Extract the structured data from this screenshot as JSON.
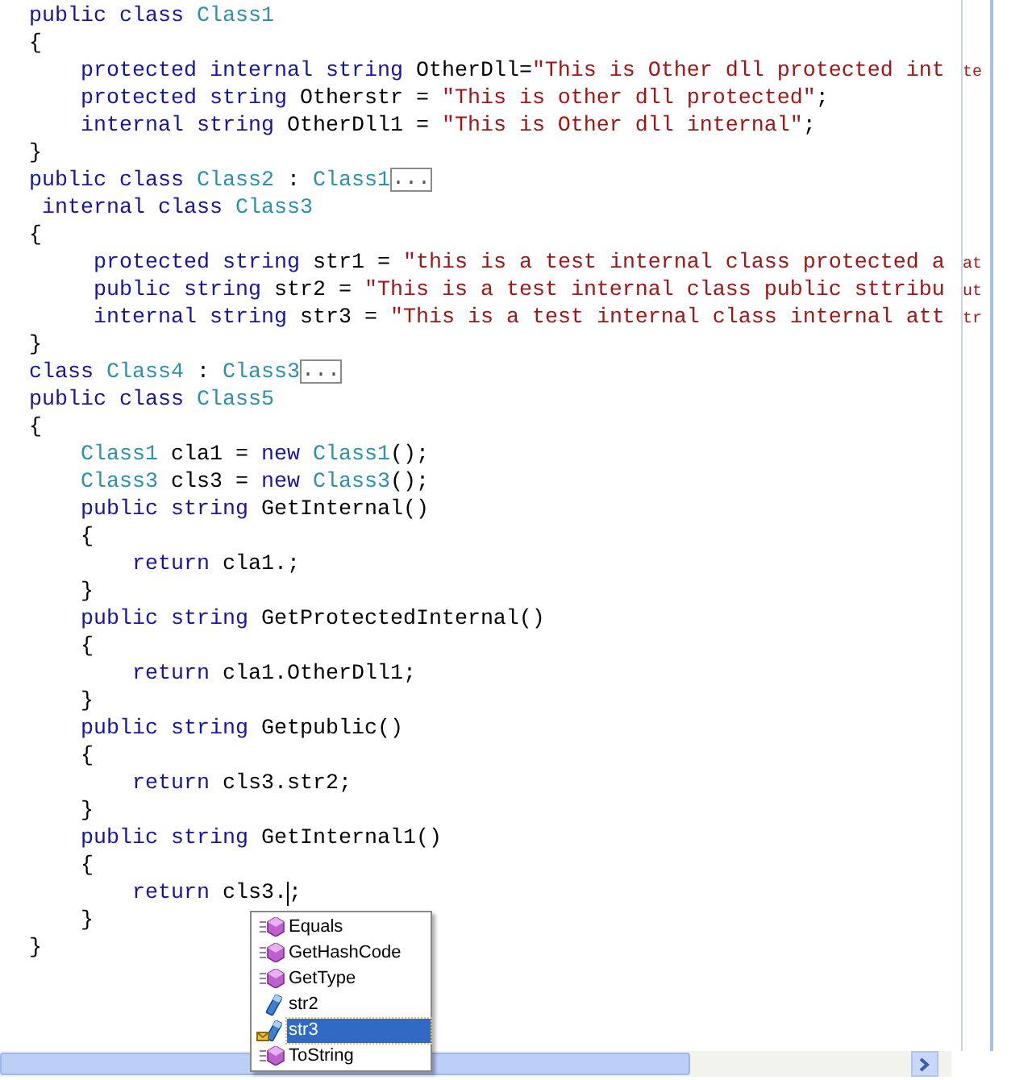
{
  "editor": {
    "lines": [
      {
        "tokens": [
          {
            "kind": "keyword",
            "text": "public class "
          },
          {
            "kind": "type",
            "text": "Class1"
          }
        ]
      },
      {
        "tokens": [
          {
            "kind": "plain",
            "text": "{"
          }
        ]
      },
      {
        "tokens": [
          {
            "kind": "keyword",
            "text": "    protected internal string "
          },
          {
            "kind": "plain",
            "text": "OtherDll="
          },
          {
            "kind": "string",
            "text": "\"This is Other dll protected int"
          }
        ],
        "margin_text": "te"
      },
      {
        "tokens": [
          {
            "kind": "keyword",
            "text": "    protected string "
          },
          {
            "kind": "plain",
            "text": "Otherstr = "
          },
          {
            "kind": "string",
            "text": "\"This is other dll protected\""
          },
          {
            "kind": "plain",
            "text": ";"
          }
        ]
      },
      {
        "tokens": [
          {
            "kind": "keyword",
            "text": "    internal string "
          },
          {
            "kind": "plain",
            "text": "OtherDll1 = "
          },
          {
            "kind": "string",
            "text": "\"This is Other dll internal\""
          },
          {
            "kind": "plain",
            "text": ";"
          }
        ]
      },
      {
        "tokens": [
          {
            "kind": "plain",
            "text": "}"
          }
        ]
      },
      {
        "tokens": [
          {
            "kind": "keyword",
            "text": "public class "
          },
          {
            "kind": "type",
            "text": "Class2"
          },
          {
            "kind": "plain",
            "text": " : "
          },
          {
            "kind": "type",
            "text": "Class1"
          },
          {
            "kind": "collapsed",
            "text": "..."
          }
        ]
      },
      {
        "tokens": [
          {
            "kind": "keyword",
            "text": " internal class "
          },
          {
            "kind": "type",
            "text": "Class3"
          }
        ]
      },
      {
        "tokens": [
          {
            "kind": "plain",
            "text": "{"
          }
        ]
      },
      {
        "tokens": [
          {
            "kind": "keyword",
            "text": "     protected string "
          },
          {
            "kind": "plain",
            "text": "str1 = "
          },
          {
            "kind": "string",
            "text": "\"this is a test internal class protected a"
          }
        ],
        "margin_text": "at"
      },
      {
        "tokens": [
          {
            "kind": "keyword",
            "text": "     public string "
          },
          {
            "kind": "plain",
            "text": "str2 = "
          },
          {
            "kind": "string",
            "text": "\"This is a test internal class public sttribu"
          }
        ],
        "margin_text": "ut"
      },
      {
        "tokens": [
          {
            "kind": "keyword",
            "text": "     internal string "
          },
          {
            "kind": "plain",
            "text": "str3 = "
          },
          {
            "kind": "string",
            "text": "\"This is a test internal class internal att"
          }
        ],
        "margin_text": "tr"
      },
      {
        "tokens": [
          {
            "kind": "plain",
            "text": "}"
          }
        ]
      },
      {
        "tokens": [
          {
            "kind": "keyword",
            "text": "class "
          },
          {
            "kind": "type",
            "text": "Class4"
          },
          {
            "kind": "plain",
            "text": " : "
          },
          {
            "kind": "type",
            "text": "Class3"
          },
          {
            "kind": "collapsed",
            "text": "..."
          }
        ]
      },
      {
        "tokens": [
          {
            "kind": "keyword",
            "text": "public class "
          },
          {
            "kind": "type",
            "text": "Class5"
          }
        ]
      },
      {
        "tokens": [
          {
            "kind": "plain",
            "text": "{"
          }
        ]
      },
      {
        "tokens": [
          {
            "kind": "type",
            "text": "    Class1"
          },
          {
            "kind": "plain",
            "text": " cla1 = "
          },
          {
            "kind": "keyword",
            "text": "new "
          },
          {
            "kind": "type",
            "text": "Class1"
          },
          {
            "kind": "plain",
            "text": "();"
          }
        ]
      },
      {
        "tokens": [
          {
            "kind": "type",
            "text": "    Class3"
          },
          {
            "kind": "plain",
            "text": " cls3 = "
          },
          {
            "kind": "keyword",
            "text": "new "
          },
          {
            "kind": "type",
            "text": "Class3"
          },
          {
            "kind": "plain",
            "text": "();"
          }
        ]
      },
      {
        "tokens": [
          {
            "kind": "keyword",
            "text": "    public string "
          },
          {
            "kind": "plain",
            "text": "GetInternal()"
          }
        ]
      },
      {
        "tokens": [
          {
            "kind": "plain",
            "text": "    {"
          }
        ]
      },
      {
        "tokens": [
          {
            "kind": "keyword",
            "text": "        return "
          },
          {
            "kind": "plain",
            "text": "cla1.;"
          }
        ]
      },
      {
        "tokens": [
          {
            "kind": "plain",
            "text": "    }"
          }
        ]
      },
      {
        "tokens": [
          {
            "kind": "keyword",
            "text": "    public string "
          },
          {
            "kind": "plain",
            "text": "GetProtectedInternal()"
          }
        ]
      },
      {
        "tokens": [
          {
            "kind": "plain",
            "text": "    {"
          }
        ]
      },
      {
        "tokens": [
          {
            "kind": "keyword",
            "text": "        return "
          },
          {
            "kind": "plain",
            "text": "cla1.OtherDll1;"
          }
        ]
      },
      {
        "tokens": [
          {
            "kind": "plain",
            "text": "    }"
          }
        ]
      },
      {
        "tokens": [
          {
            "kind": "keyword",
            "text": "    public string "
          },
          {
            "kind": "plain",
            "text": "Getpublic()"
          }
        ]
      },
      {
        "tokens": [
          {
            "kind": "plain",
            "text": "    {"
          }
        ]
      },
      {
        "tokens": [
          {
            "kind": "keyword",
            "text": "        return "
          },
          {
            "kind": "plain",
            "text": "cls3.str2;"
          }
        ]
      },
      {
        "tokens": [
          {
            "kind": "plain",
            "text": "    }"
          }
        ]
      },
      {
        "tokens": [
          {
            "kind": "keyword",
            "text": "    public string "
          },
          {
            "kind": "plain",
            "text": "GetInternal1()"
          }
        ]
      },
      {
        "tokens": [
          {
            "kind": "plain",
            "text": "    {"
          }
        ]
      },
      {
        "tokens": [
          {
            "kind": "keyword",
            "text": "        return "
          },
          {
            "kind": "plain",
            "text": "cls3."
          },
          {
            "kind": "caret"
          },
          {
            "kind": "plain",
            "text": ";"
          }
        ]
      },
      {
        "tokens": [
          {
            "kind": "plain",
            "text": "    }"
          }
        ]
      },
      {
        "tokens": [
          {
            "kind": "plain",
            "text": "}"
          }
        ]
      }
    ]
  },
  "completion_list": {
    "items": [
      {
        "label": "Equals",
        "kind": "method",
        "internal": false,
        "selected": false
      },
      {
        "label": "GetHashCode",
        "kind": "method",
        "internal": false,
        "selected": false
      },
      {
        "label": "GetType",
        "kind": "method",
        "internal": false,
        "selected": false
      },
      {
        "label": "str2",
        "kind": "field",
        "internal": false,
        "selected": false
      },
      {
        "label": "str3",
        "kind": "field",
        "internal": true,
        "selected": true
      },
      {
        "label": "ToString",
        "kind": "method",
        "internal": false,
        "selected": false
      }
    ]
  }
}
